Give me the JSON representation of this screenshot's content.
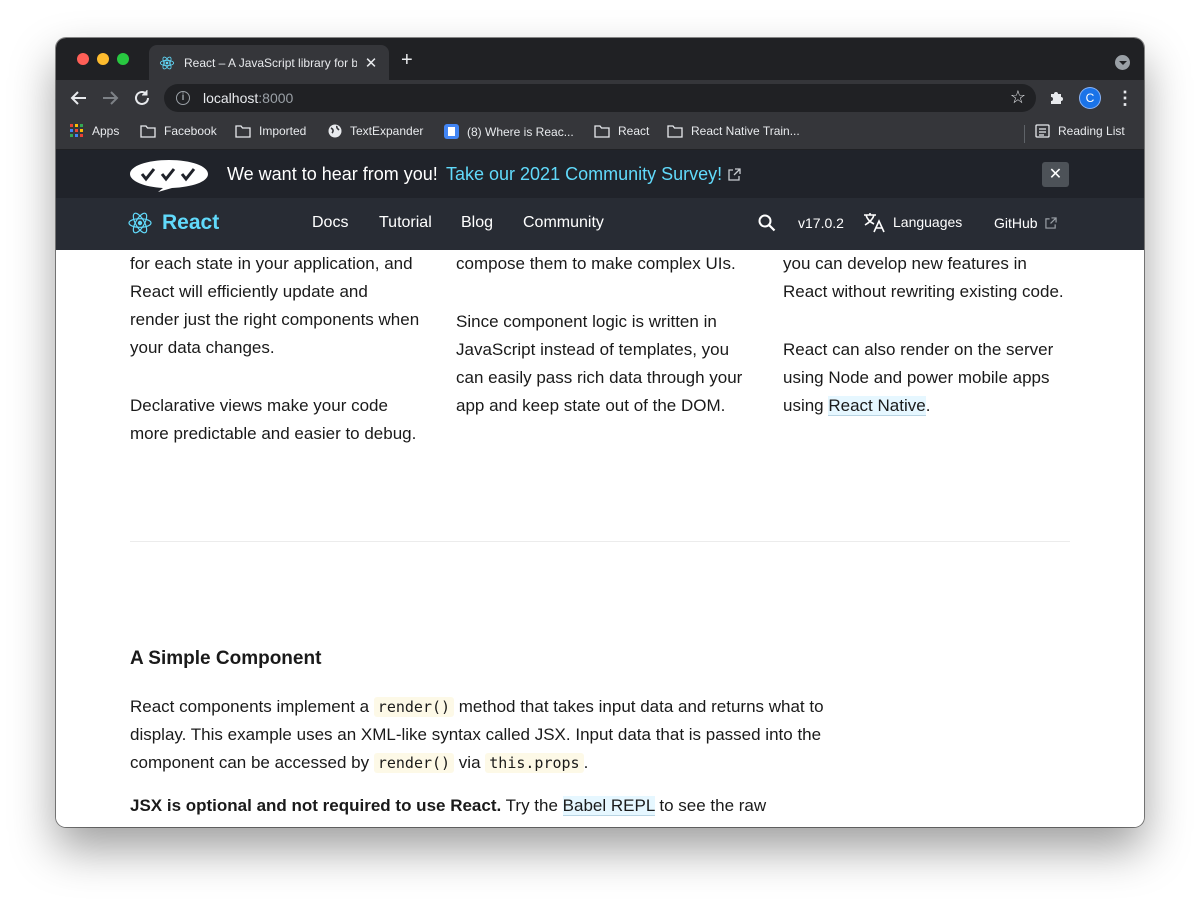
{
  "browser": {
    "tab_title": "React – A JavaScript library for building user interfaces",
    "tab_close": "✕",
    "new_tab": "+",
    "url_host": "localhost",
    "url_port": ":8000",
    "avatar_letter": "C",
    "bookmarks": {
      "apps": "Apps",
      "facebook": "Facebook",
      "imported": "Imported",
      "textexpander": "TextExpander",
      "where_is_react": "(8) Where is Reac...",
      "react": "React",
      "react_native": "React Native Train...",
      "reading_list": "Reading List"
    }
  },
  "banner": {
    "text": "We want to hear from you!",
    "link": "Take our 2021 Community Survey!",
    "close": "✕"
  },
  "header": {
    "brand": "React",
    "nav": [
      "Docs",
      "Tutorial",
      "Blog",
      "Community"
    ],
    "version": "v17.0.2",
    "languages": "Languages",
    "github": "GitHub"
  },
  "content": {
    "col1": {
      "p1": "for each state in your application, and React will efficiently update and render just the right components when your data changes.",
      "p2": "Declarative views make your code more predictable and easier to debug."
    },
    "col2": {
      "p1": "compose them to make complex UIs.",
      "p2": "Since component logic is written in JavaScript instead of templates, you can easily pass rich data through your app and keep state out of the DOM."
    },
    "col3": {
      "p1": "you can develop new features in React without rewriting existing code.",
      "p2_before": "React can also render on the server using Node and power mobile apps using ",
      "p2_link": "React Native",
      "p2_after": "."
    },
    "section_title": "A Simple Component",
    "para1": {
      "t1": "React components implement a ",
      "c1": "render()",
      "t2": " method that takes input data and returns what to display. This example uses an XML-like syntax called JSX. Input data that is passed into the component can be accessed by ",
      "c2": "render()",
      "t3": " via ",
      "c3": "this.props",
      "t4": "."
    },
    "para2": {
      "bold": "JSX is optional and not required to use React.",
      "t1": " Try the ",
      "link": "Babel REPL",
      "t2": " to see the raw JavaScript"
    }
  }
}
